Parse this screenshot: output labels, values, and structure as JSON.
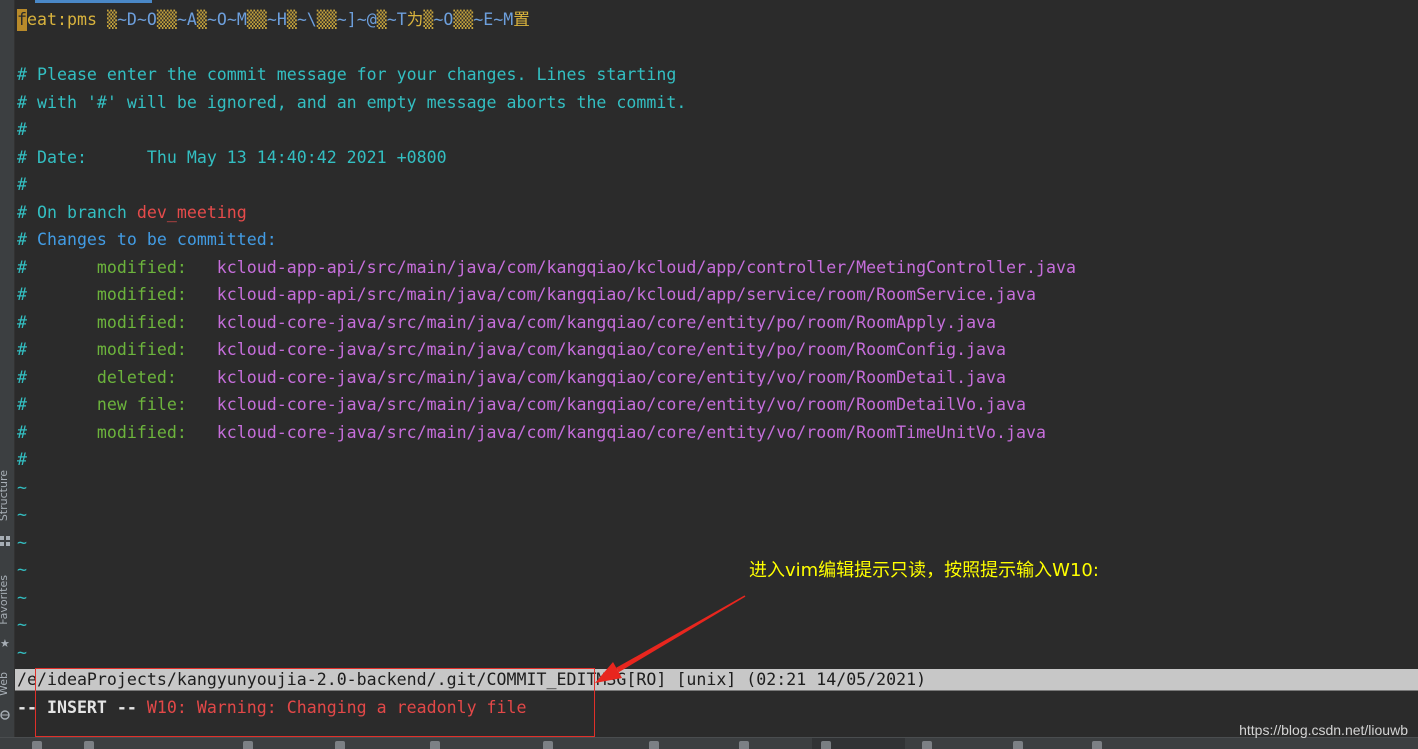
{
  "ide": {
    "sidebar_tabs": [
      {
        "label": "Structure",
        "icon": "structure-icon"
      },
      {
        "label": "Favorites",
        "icon": "star-icon"
      },
      {
        "label": "Web",
        "icon": "web-icon"
      }
    ]
  },
  "palette": {
    "bg": "#2b2b2b",
    "panel": "#3c3f41",
    "comment": "#33bfc2",
    "heading": "#429ce4",
    "branch": "#e64b4b",
    "status": "#6cb43c",
    "path": "#c66edb",
    "subject": "#d9b33d",
    "garble": "#c8a53c",
    "special": "#6d9fdc",
    "cursor-bg": "#b88a2a",
    "statusbar-bg": "#c7c7c7",
    "statusbar-fg": "#1d1d1d",
    "mode": "#e4e4e4",
    "warning": "#e34848",
    "accent": "#4a88c7",
    "annotation": "#ffff00",
    "arrow": "#e8261e",
    "box": "#e0302a",
    "watermark": "#d4d4d4"
  },
  "editor": {
    "subject_segments": [
      "f",
      "eat:pms ",
      "▒",
      "~D~O",
      "▒▒",
      "~A",
      "▒",
      "~O~M",
      "▒▒",
      "~H",
      "▒",
      "~\\",
      "▒▒",
      "~]~@",
      "▒",
      "~T",
      "为",
      "▒",
      "~O",
      "▒▒",
      "~E~M",
      "置"
    ],
    "intro_lines": [
      "# Please enter the commit message for your changes. Lines starting",
      "# with '#' will be ignored, and an empty message aborts the commit.",
      "#",
      "# Date:      Thu May 13 14:40:42 2021 +0800",
      "#"
    ],
    "branch_line": {
      "prefix": "# On branch ",
      "branch": "dev_meeting"
    },
    "changes_line": {
      "prefix": "# ",
      "heading": "Changes to be committed:"
    },
    "file_prefix": "#",
    "files": [
      {
        "status": "modified:",
        "path": "kcloud-app-api/src/main/java/com/kangqiao/kcloud/app/controller/MeetingController.java"
      },
      {
        "status": "modified:",
        "path": "kcloud-app-api/src/main/java/com/kangqiao/kcloud/app/service/room/RoomService.java"
      },
      {
        "status": "modified:",
        "path": "kcloud-core-java/src/main/java/com/kangqiao/core/entity/po/room/RoomApply.java"
      },
      {
        "status": "modified:",
        "path": "kcloud-core-java/src/main/java/com/kangqiao/core/entity/po/room/RoomConfig.java"
      },
      {
        "status": "deleted:",
        "path": "kcloud-core-java/src/main/java/com/kangqiao/core/entity/vo/room/RoomDetail.java"
      },
      {
        "status": "new file:",
        "path": "kcloud-core-java/src/main/java/com/kangqiao/core/entity/vo/room/RoomDetailVo.java"
      },
      {
        "status": "modified:",
        "path": "kcloud-core-java/src/main/java/com/kangqiao/core/entity/vo/room/RoomTimeUnitVo.java"
      }
    ],
    "closing_line": "#",
    "empty_lines": [
      "~",
      "~",
      "~",
      "~",
      "~",
      "~",
      "~"
    ]
  },
  "statusline": {
    "text": "/e/ideaProjects/kangyunyoujia-2.0-backend/.git/COMMIT_EDITMSG[RO] [unix] (02:21 14/05/2021)"
  },
  "cmdline": {
    "mode": "-- INSERT --",
    "message": "W10: Warning: Changing a readonly file"
  },
  "annotation": {
    "text": "进入vim编辑提示只读，按照提示输入W10:"
  },
  "watermark": {
    "text": "https://blog.csdn.net/liouwb"
  }
}
